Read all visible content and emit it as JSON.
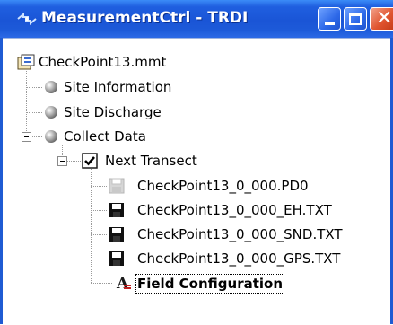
{
  "window": {
    "title": "MeasurementCtrl - TRDI",
    "close_glyph": "✕"
  },
  "tree": {
    "root": {
      "label": "CheckPoint13.mmt",
      "icon": "project-icon"
    },
    "items": [
      {
        "label": "Site Information",
        "icon": "gray-sphere-icon"
      },
      {
        "label": "Site Discharge",
        "icon": "gray-sphere-icon"
      },
      {
        "label": "Collect Data",
        "icon": "gray-sphere-icon",
        "expanded": true
      }
    ],
    "transect": {
      "label": "Next Transect",
      "checked": true,
      "expanded": true
    },
    "files": [
      {
        "label": "CheckPoint13_0_000.PD0",
        "icon": "floppy-disabled-icon"
      },
      {
        "label": "CheckPoint13_0_000_EH.TXT",
        "icon": "floppy-icon"
      },
      {
        "label": "CheckPoint13_0_000_SND.TXT",
        "icon": "floppy-icon"
      },
      {
        "label": "CheckPoint13_0_000_GPS.TXT",
        "icon": "floppy-icon"
      }
    ],
    "config": {
      "label": "Field Configuration",
      "icon": "config-A-icon"
    }
  }
}
